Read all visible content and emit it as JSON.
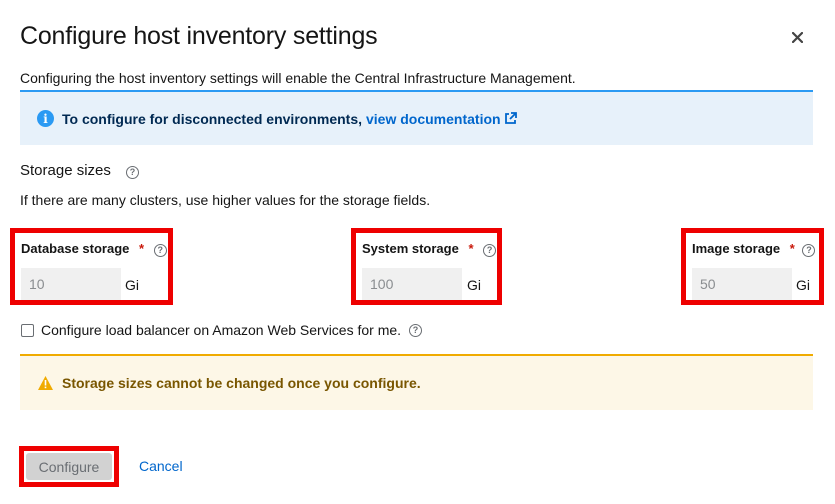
{
  "modal": {
    "title": "Configure host inventory settings",
    "description": "Configuring the host inventory settings will enable the Central Infrastructure Management."
  },
  "info_alert": {
    "text": "To configure for disconnected environments,",
    "link_text": "view documentation",
    "icon": "info-circle-icon",
    "link_icon": "external-link-icon"
  },
  "storage": {
    "title": "Storage sizes",
    "description": "If there are many clusters, use higher values for the storage fields.",
    "fields": [
      {
        "label": "Database storage",
        "required_mark": "*",
        "value": "10",
        "unit": "Gi"
      },
      {
        "label": "System storage",
        "required_mark": "*",
        "value": "100",
        "unit": "Gi"
      },
      {
        "label": "Image storage",
        "required_mark": "*",
        "value": "50",
        "unit": "Gi"
      }
    ]
  },
  "load_balancer": {
    "label": "Configure load balancer on Amazon Web Services for me.",
    "checked": false
  },
  "warning_alert": {
    "text": "Storage sizes cannot be changed once you configure.",
    "icon": "warning-triangle-icon"
  },
  "actions": {
    "configure_label": "Configure",
    "cancel_label": "Cancel"
  },
  "colors": {
    "primary_link": "#0066cc",
    "info_bg": "#e7f1fa",
    "warning_bg": "#fdf7e7",
    "highlight_border": "#ee0000",
    "required": "#c9190b"
  }
}
